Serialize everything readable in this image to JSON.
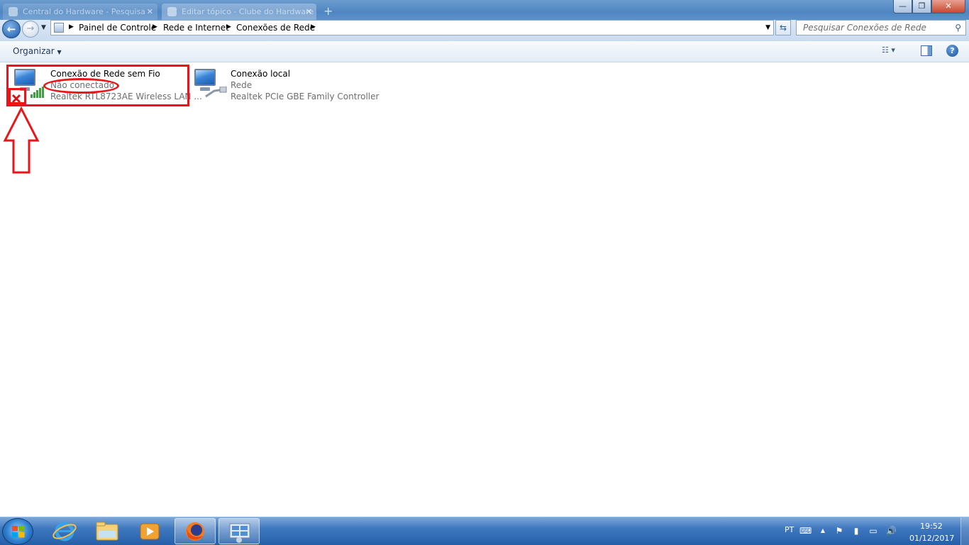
{
  "browser_tabs": [
    {
      "label": "Central do Hardware - Pesquisa"
    },
    {
      "label": "Editar tópico - Clube do Hardware"
    }
  ],
  "window_controls": {
    "minimize": "—",
    "maximize": "❐",
    "close": "✕"
  },
  "navigation": {
    "back_glyph": "←",
    "forward_glyph": "→",
    "breadcrumbs": [
      "Painel de Controle",
      "Rede e Internet",
      "Conexões de Rede"
    ],
    "search_placeholder": "Pesquisar Conexões de Rede"
  },
  "command_bar": {
    "organize_label": "Organizar"
  },
  "connections": [
    {
      "name": "Conexão de Rede sem Fio",
      "status": "Não conectado",
      "device": "Realtek RTL8723AE Wireless LAN ...",
      "icon": "wireless-disconnected-icon"
    },
    {
      "name": "Conexão local",
      "status": "Rede",
      "device": "Realtek PCIe GBE Family Controller",
      "icon": "ethernet-network-icon"
    }
  ],
  "annotation_color": "#e8161b",
  "taskbar": {
    "language": "PT",
    "time": "19:52",
    "date": "01/12/2017"
  }
}
